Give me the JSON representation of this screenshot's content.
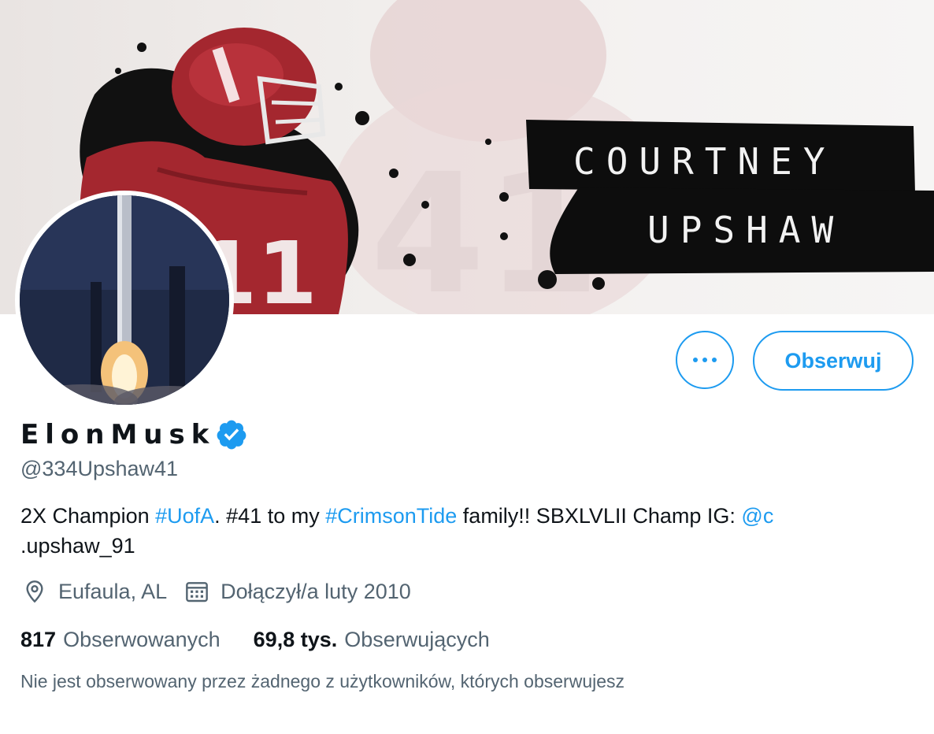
{
  "banner": {
    "line1": "COURTNEY",
    "line2": "UPSHAW"
  },
  "actions": {
    "more_label": "More",
    "follow_label": "Obserwuj"
  },
  "profile": {
    "name": "ElonMusk",
    "handle": "@334Upshaw41",
    "verified": true,
    "bio": {
      "t1": "2X Champion ",
      "h1": "#UofA",
      "t2": ". #41 to my ",
      "h2": "#CrimsonTide",
      "t3": " family!! SBXLVLII Champ IG: ",
      "m1a": "@c",
      "m1b": ".upshaw_91"
    },
    "location": "Eufaula, AL",
    "joined": "Dołączył/a luty 2010"
  },
  "stats": {
    "following_count": "817",
    "following_label": "Obserwowanych",
    "followers_count": "69,8 tys.",
    "followers_label": "Obserwujących"
  },
  "footer_note": "Nie jest obserwowany przez żadnego z użytkowników, których obserwujesz",
  "icons": {
    "location": "location-pin-icon",
    "calendar": "calendar-icon",
    "verified": "verified-badge-icon",
    "more": "more-dots-icon"
  },
  "colors": {
    "accent": "#1d9bf0",
    "text_primary": "#0f1419",
    "text_secondary": "#536471",
    "banner_jersey": "#a4272f"
  }
}
